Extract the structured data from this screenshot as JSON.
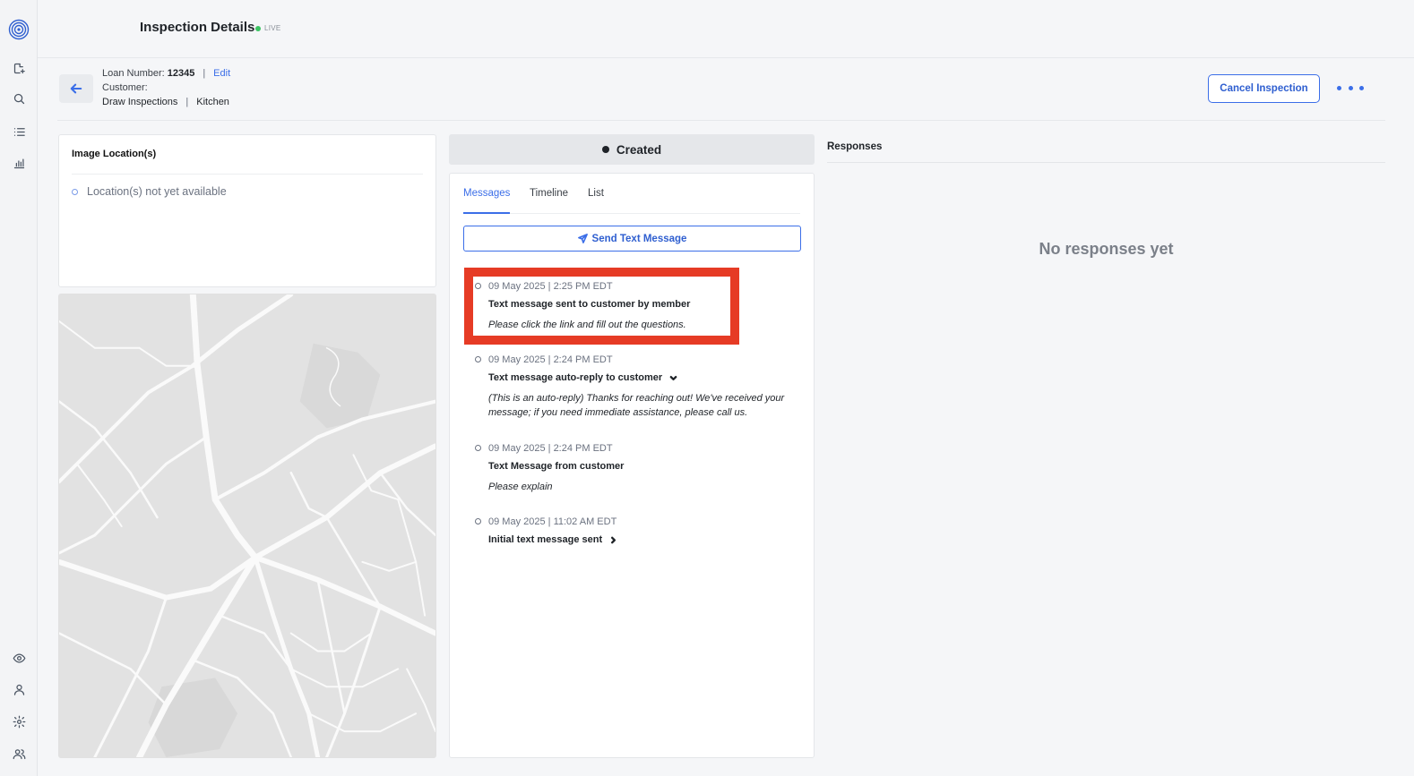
{
  "sidebar": {
    "logo": "fingerprint-logo",
    "top_icons": [
      "new-inspection-icon",
      "search-icon",
      "list-icon",
      "analytics-icon"
    ],
    "bottom_icons": [
      "eye-icon",
      "user-icon",
      "settings-icon",
      "team-icon"
    ]
  },
  "header": {
    "title": "Inspection Details",
    "live_badge": "LIVE",
    "live_color": "#3cc463"
  },
  "info": {
    "loan_label": "Loan Number:",
    "loan_number": "12345",
    "separator": "|",
    "edit_label": "Edit",
    "customer_label": "Customer:",
    "customer_value": "",
    "category": "Draw Inspections",
    "location": "Kitchen"
  },
  "actions": {
    "cancel_label": "Cancel Inspection",
    "more_icon": "more-horizontal-icon"
  },
  "image_locations": {
    "title": "Image Location(s)",
    "empty_text": "Location(s) not yet available"
  },
  "status": {
    "label": "Created"
  },
  "messages_panel": {
    "tabs": [
      {
        "label": "Messages",
        "active": true
      },
      {
        "label": "Timeline",
        "active": false
      },
      {
        "label": "List",
        "active": false
      }
    ],
    "send_label": "Send Text Message",
    "items": [
      {
        "timestamp": "09 May 2025 | 2:25 PM EDT",
        "title": "Text message sent to customer by member",
        "body": "Please click the link and fill out the questions.",
        "highlighted": true
      },
      {
        "timestamp": "09 May 2025 | 2:24 PM EDT",
        "title": "Text message auto-reply to customer",
        "body": "(This is an auto-reply) Thanks for reaching out! We've received your message; if you need immediate assistance, please call us.",
        "toggle": "chevron-down-icon"
      },
      {
        "timestamp": "09 May 2025 | 2:24 PM EDT",
        "title": "Text Message from customer",
        "body": "Please explain"
      },
      {
        "timestamp": "09 May 2025 | 11:02 AM EDT",
        "title": "Initial text message sent",
        "toggle": "chevron-right-icon"
      }
    ]
  },
  "responses": {
    "title": "Responses",
    "empty_text": "No responses yet"
  },
  "colors": {
    "accent": "#3b6ee8",
    "highlight": "#e63b25"
  }
}
